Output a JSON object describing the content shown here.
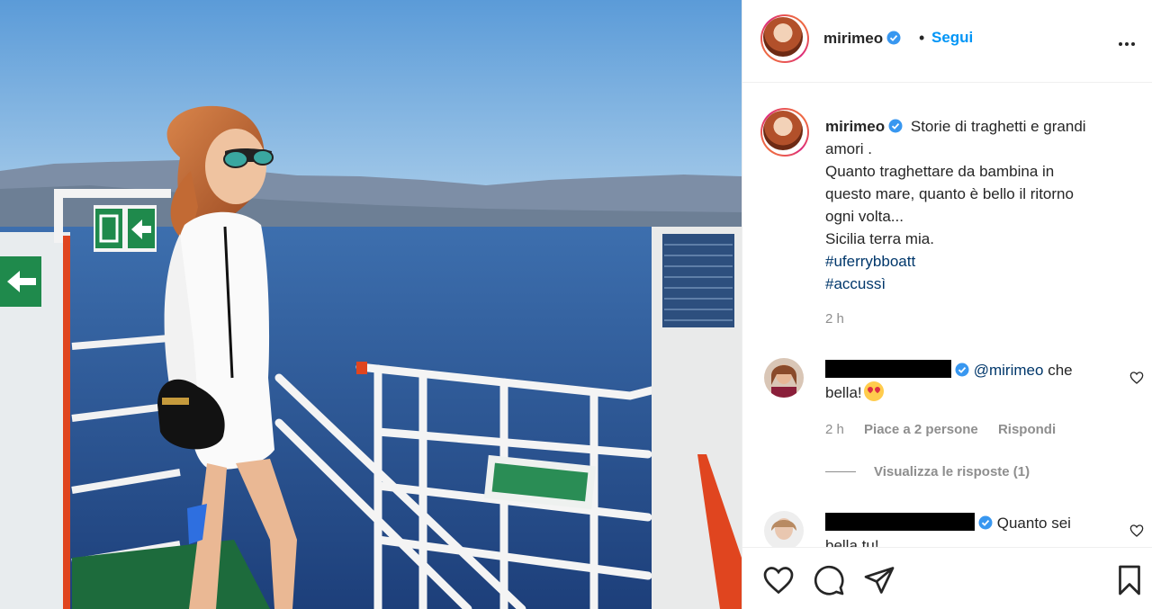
{
  "post": {
    "username": "mirimeo",
    "verified": true,
    "follow_label": "Segui",
    "separator": "•"
  },
  "caption": {
    "username": "mirimeo",
    "lines": [
      "Storie di traghetti e grandi",
      "amori .",
      "Quanto traghettare da bambina in",
      "questo mare, quanto è bello il ritorno",
      "ogni volta...",
      "Sicilia terra mia."
    ],
    "hashtags": [
      "#uferrybboatt",
      "#accussì"
    ],
    "time": "2 h"
  },
  "comments": [
    {
      "text_mention": "@mirimeo",
      "text_line1": "che",
      "text_line2": "bella!",
      "time": "2 h",
      "likes": "Piace a 2 persone",
      "reply": "Rispondi",
      "view_replies": "Visualizza le risposte (1)"
    },
    {
      "text_line1": "Quanto sei",
      "text_line2": "bella tu!"
    }
  ],
  "colors": {
    "accent": "#0095f6",
    "hashtag": "#00376b",
    "muted": "#8e8e8e",
    "text": "#262626"
  },
  "icons": [
    "verified-badge-icon",
    "more-options-icon",
    "heart-icon",
    "comment-icon",
    "share-icon",
    "bookmark-icon"
  ]
}
